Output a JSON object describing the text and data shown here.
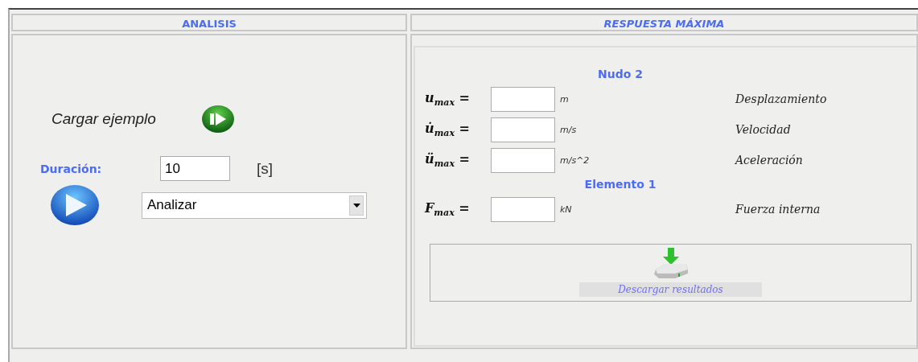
{
  "analysis": {
    "title": "ANALISIS",
    "load_example": {
      "label": "Cargar ejemplo"
    },
    "duration": {
      "label": "Duración:",
      "value": "10",
      "unit": "[s]"
    },
    "mode_select": {
      "value": "Analizar"
    }
  },
  "max_response": {
    "title": "RESPUESTA MÁXIMA",
    "groups": [
      {
        "title": "Nudo 2",
        "rows": [
          {
            "symbol": "u$_{max}$ =",
            "unit": "m",
            "description": "Desplazamiento"
          },
          {
            "symbol": "u̇$_{max}$ =",
            "unit": "m/s",
            "description": "Velocidad"
          },
          {
            "symbol": "ü$_{max}$ =",
            "unit": "m/s^2",
            "description": "Aceleración"
          }
        ]
      },
      {
        "title": "Elemento 1",
        "rows": [
          {
            "symbol": "F$_{max}$ =",
            "unit": "kN",
            "description": "Fuerza interna"
          }
        ]
      }
    ],
    "download": {
      "label": "Descargar resultados"
    }
  }
}
